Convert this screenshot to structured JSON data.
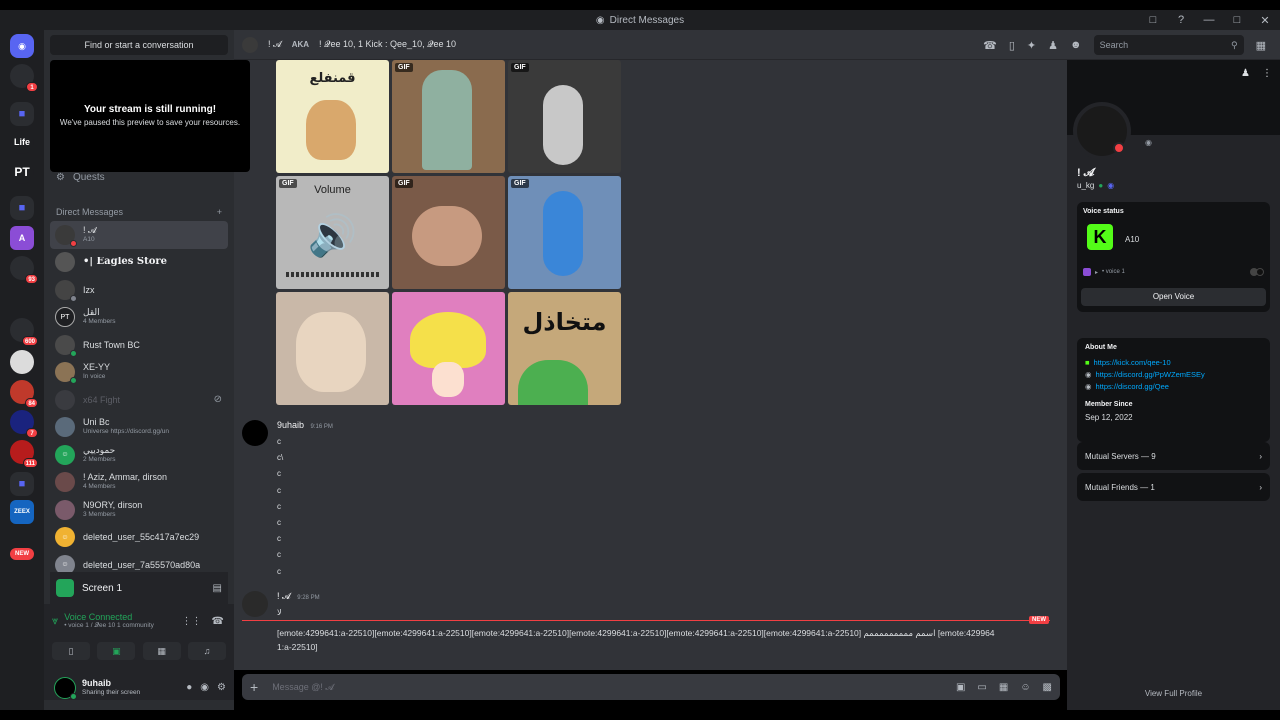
{
  "window": {
    "title": "Direct Messages"
  },
  "sidebar": {
    "search_label": "Find or start a conversation",
    "stream_popup": {
      "heading": "Your stream is still running!",
      "text": "We've paused this preview to save your resources."
    },
    "quests_label": "Quests",
    "dm_header": "Direct Messages",
    "dm_items": [
      {
        "name": "! 𝓐",
        "sub": "A10"
      },
      {
        "name": "•| Eagles Store",
        "sub": ""
      },
      {
        "name": "Izx",
        "sub": ""
      },
      {
        "name": "القل",
        "sub": "4 Members"
      },
      {
        "name": "Rust Town BC",
        "sub": ""
      },
      {
        "name": "XE-YY",
        "sub": "In voice"
      },
      {
        "name": "x64 Fight",
        "sub": ""
      },
      {
        "name": "Uni Bc",
        "sub": "Universe https://discord.gg/un"
      },
      {
        "name": "حمودييي",
        "sub": "2 Members"
      },
      {
        "name": "! Aziz, Ammar, dirson",
        "sub": "4 Members"
      },
      {
        "name": "N9ORY, dirson",
        "sub": "3 Members"
      },
      {
        "name": "deleted_user_55c417a7ec29",
        "sub": ""
      },
      {
        "name": "deleted_user_7a55570ad80a",
        "sub": ""
      }
    ],
    "screen_panel": {
      "label": "Screen 1"
    },
    "voice": {
      "title": "Voice Connected",
      "sub": "• voice 1 / 𝓠ee 10 1 community"
    },
    "user": {
      "name": "9uhaib",
      "status": "Sharing their screen"
    }
  },
  "servers": [
    {
      "label": "A",
      "color": "#8b4dd6",
      "badge": ""
    },
    {
      "label": "Life",
      "color": "#1e1f22",
      "badge": ""
    },
    {
      "label": "PT",
      "color": "#1e1f22",
      "badge": ""
    },
    {
      "label": "",
      "color": "#2b2d31",
      "badge": "93"
    },
    {
      "label": "",
      "color": "#2b2d31",
      "badge": "600"
    },
    {
      "label": "",
      "color": "#c0392b",
      "badge": "84"
    },
    {
      "label": "",
      "color": "#1a237e",
      "badge": "7"
    },
    {
      "label": "",
      "color": "#b71c1c",
      "badge": "111"
    },
    {
      "label": "ZEEX",
      "color": "#1565c0",
      "badge": ""
    },
    {
      "label": "NEW",
      "color": "#f23f43",
      "badge": ""
    }
  ],
  "chat_header": {
    "name": "! 𝓐",
    "aka_label": "AKA",
    "aka_names": "! 𝓠ee 10, 1 Kick : Qee_10, 𝓠ee 10",
    "search_placeholder": "Search"
  },
  "gifs": [
    {
      "tag": "",
      "caption": "قمنفلع",
      "bg": "#f1edc9"
    },
    {
      "tag": "GIF",
      "caption": "",
      "bg": "#8a6b4e"
    },
    {
      "tag": "GIF",
      "caption": "",
      "bg": "#3a3a3a"
    },
    {
      "tag": "GIF",
      "caption": "Volume",
      "bg": "#b8b8b8"
    },
    {
      "tag": "GIF",
      "caption": "",
      "bg": "#7a5a48"
    },
    {
      "tag": "GIF",
      "caption": "",
      "bg": "#6f8fb8"
    },
    {
      "tag": "",
      "caption": "",
      "bg": "#c9b8a8"
    },
    {
      "tag": "",
      "caption": "",
      "bg": "#e07fbf"
    },
    {
      "tag": "",
      "caption": "متخاذل",
      "bg": "#c5a87a"
    }
  ],
  "messages": [
    {
      "author": "9uhaib",
      "time": "9:16 PM",
      "lines": [
        "c",
        "c\\",
        "c",
        "c",
        "c",
        "c",
        "c",
        "c",
        "c"
      ]
    },
    {
      "author": "! 𝓐",
      "time": "9:28 PM",
      "lines": [
        "لا"
      ]
    }
  ],
  "new_label": "NEW",
  "emote_text": "[emote:4299641:a-22510][emote:4299641:a-22510][emote:4299641:a-22510][emote:4299641:a-22510][emote:4299641:a-22510][emote:4299641:a-22510] اسمم مممممممممم [emote:4299641:a-22510]",
  "composer": {
    "placeholder": "Message @! 𝓐"
  },
  "profile": {
    "display_name": "! 𝓐",
    "username": "u_kg",
    "voice_status_title": "Voice status",
    "voice_status_name": "A10",
    "voice_channel": "• voice 1",
    "open_voice": "Open Voice",
    "about_title": "About Me",
    "links": [
      "https://kick.com/qee-10",
      "https://discord.gg/PpWZemESEy",
      "https://discord.gg/Qee"
    ],
    "member_since_title": "Member Since",
    "member_since": "Sep 12, 2022",
    "mutual_servers": "Mutual Servers — 9",
    "mutual_friends": "Mutual Friends — 1",
    "view_full": "View Full Profile"
  },
  "colors": {
    "accent": "#5865f2",
    "online": "#23a55a",
    "dnd": "#f23f43",
    "kick": "#53fc18",
    "link": "#00a8fc"
  }
}
